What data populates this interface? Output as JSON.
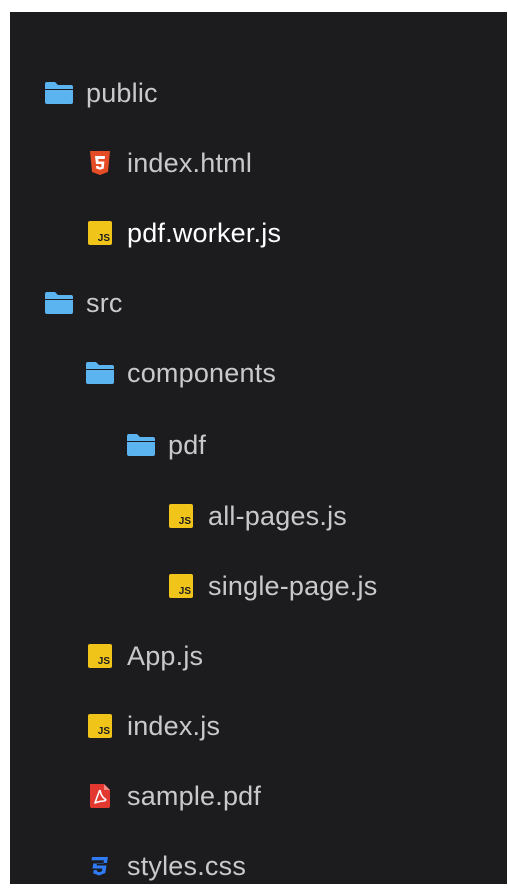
{
  "colors": {
    "panel_bg": "#1c1c1f",
    "label": "#c9c9cb",
    "label_selected": "#ffffff",
    "folder": "#5bb3f0",
    "js": "#f0c419",
    "html5": "#e44d26",
    "pdf": "#e2382f",
    "css3": "#2f7bf5"
  },
  "file_tree": {
    "items": [
      {
        "label": "public",
        "icon": "folder-icon",
        "depth": 0
      },
      {
        "label": "index.html",
        "icon": "html5-icon",
        "depth": 1
      },
      {
        "label": "pdf.worker.js",
        "icon": "js-file-icon",
        "depth": 1,
        "selected": true
      },
      {
        "label": "src",
        "icon": "folder-icon",
        "depth": 0
      },
      {
        "label": "components",
        "icon": "folder-icon",
        "depth": 1
      },
      {
        "label": "pdf",
        "icon": "folder-icon",
        "depth": 2
      },
      {
        "label": "all-pages.js",
        "icon": "js-file-icon",
        "depth": 3
      },
      {
        "label": "single-page.js",
        "icon": "js-file-icon",
        "depth": 3
      },
      {
        "label": "App.js",
        "icon": "js-file-icon",
        "depth": 1
      },
      {
        "label": "index.js",
        "icon": "js-file-icon",
        "depth": 1
      },
      {
        "label": "sample.pdf",
        "icon": "pdf-file-icon",
        "depth": 1
      },
      {
        "label": "styles.css",
        "icon": "css3-icon",
        "depth": 1
      }
    ]
  }
}
